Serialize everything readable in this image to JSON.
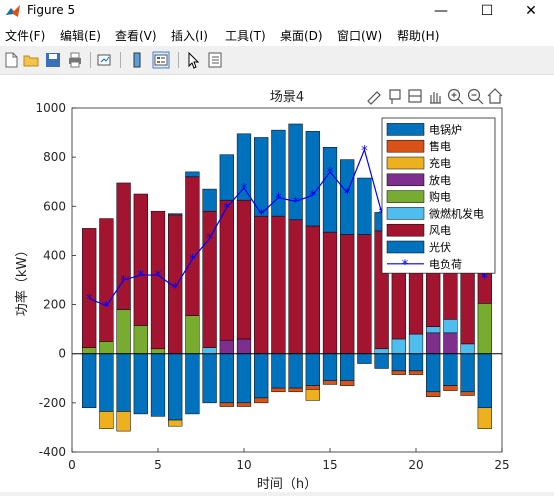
{
  "window": {
    "title": "Figure 5",
    "min_label": "—",
    "max_label": "☐",
    "close_label": "✕"
  },
  "menu": [
    {
      "label": "文件(F)"
    },
    {
      "label": "编辑(E)"
    },
    {
      "label": "查看(V)"
    },
    {
      "label": "插入(I)"
    },
    {
      "label": "工具(T)"
    },
    {
      "label": "桌面(D)"
    },
    {
      "label": "窗口(W)"
    },
    {
      "label": "帮助(H)"
    }
  ],
  "toolbar": [
    {
      "name": "new-figure-icon"
    },
    {
      "name": "open-file-icon"
    },
    {
      "name": "save-icon"
    },
    {
      "name": "print-icon"
    },
    {
      "name": "link-plot-icon"
    },
    {
      "name": "colorbar-icon"
    },
    {
      "name": "legend-icon"
    },
    {
      "name": "pointer-icon"
    },
    {
      "name": "property-inspector-icon"
    }
  ],
  "axes_toolbar": [
    {
      "name": "brush-icon"
    },
    {
      "name": "data-tips-icon"
    },
    {
      "name": "restore-view-icon"
    },
    {
      "name": "pan-icon"
    },
    {
      "name": "zoom-in-icon"
    },
    {
      "name": "zoom-out-icon"
    },
    {
      "name": "home-icon"
    }
  ],
  "chart_data": {
    "type": "bar",
    "title": "场景4",
    "xlabel": "时间（h）",
    "ylabel": "功率（kW）",
    "xlim": [
      0,
      25
    ],
    "ylim": [
      -400,
      1000
    ],
    "xticks": [
      0,
      5,
      10,
      15,
      20,
      25
    ],
    "yticks": [
      -400,
      -200,
      0,
      200,
      400,
      600,
      800,
      1000
    ],
    "stacked": true,
    "legend_position": "top-right",
    "x": [
      1,
      2,
      3,
      4,
      5,
      6,
      7,
      8,
      9,
      10,
      11,
      12,
      13,
      14,
      15,
      16,
      17,
      18,
      19,
      20,
      21,
      22,
      23,
      24
    ],
    "series": [
      {
        "name": "购电",
        "color": "#77ac30",
        "values": [
          25,
          50,
          180,
          115,
          20,
          0,
          155,
          0,
          0,
          0,
          0,
          0,
          0,
          0,
          0,
          0,
          0,
          0,
          0,
          0,
          0,
          0,
          0,
          205
        ]
      },
      {
        "name": "放电",
        "color": "#7e2f8e",
        "values": [
          0,
          0,
          0,
          0,
          0,
          0,
          0,
          0,
          55,
          60,
          0,
          0,
          0,
          0,
          0,
          0,
          0,
          0,
          0,
          0,
          85,
          85,
          0,
          0
        ]
      },
      {
        "name": "微燃机发电",
        "color": "#4dbeee",
        "values": [
          0,
          0,
          0,
          0,
          0,
          0,
          0,
          25,
          0,
          0,
          0,
          0,
          0,
          0,
          0,
          0,
          0,
          20,
          60,
          80,
          25,
          55,
          40,
          0
        ]
      },
      {
        "name": "风电",
        "color": "#a2142f",
        "values": [
          485,
          500,
          515,
          535,
          560,
          565,
          565,
          555,
          570,
          565,
          560,
          560,
          545,
          520,
          495,
          485,
          485,
          480,
          430,
          420,
          400,
          415,
          395,
          195
        ]
      },
      {
        "name": "光伏",
        "color": "#0072bd",
        "values": [
          0,
          0,
          0,
          0,
          0,
          5,
          20,
          90,
          185,
          270,
          320,
          350,
          390,
          385,
          345,
          305,
          230,
          75,
          0,
          0,
          0,
          0,
          0,
          0
        ]
      },
      {
        "name": "电锅炉",
        "color": "#0072bd",
        "values": [
          -220,
          -235,
          -235,
          -245,
          -255,
          -270,
          -245,
          -200,
          -200,
          -200,
          -180,
          -140,
          -140,
          -130,
          -110,
          -110,
          -40,
          -60,
          -70,
          -70,
          -155,
          -130,
          -155,
          -220
        ]
      },
      {
        "name": "售电",
        "color": "#d95319",
        "values": [
          0,
          0,
          0,
          0,
          0,
          0,
          0,
          0,
          -15,
          -15,
          -20,
          -15,
          -15,
          -15,
          -15,
          -20,
          0,
          0,
          -15,
          -15,
          -20,
          -20,
          -15,
          0
        ]
      },
      {
        "name": "充电",
        "color": "#edb120",
        "values": [
          0,
          -70,
          -80,
          0,
          0,
          -25,
          0,
          0,
          0,
          0,
          0,
          0,
          0,
          -45,
          0,
          0,
          0,
          0,
          0,
          0,
          0,
          0,
          0,
          -85
        ]
      }
    ],
    "line": {
      "name": "电负荷",
      "color": "#0000ff",
      "marker": "*",
      "values": [
        225,
        195,
        300,
        320,
        320,
        270,
        385,
        470,
        595,
        675,
        570,
        635,
        620,
        645,
        740,
        655,
        830,
        575,
        520,
        450,
        420,
        420,
        420,
        310
      ]
    },
    "legend": [
      "电锅炉",
      "售电",
      "充电",
      "放电",
      "购电",
      "微燃机发电",
      "风电",
      "光伏",
      "电负荷"
    ]
  }
}
